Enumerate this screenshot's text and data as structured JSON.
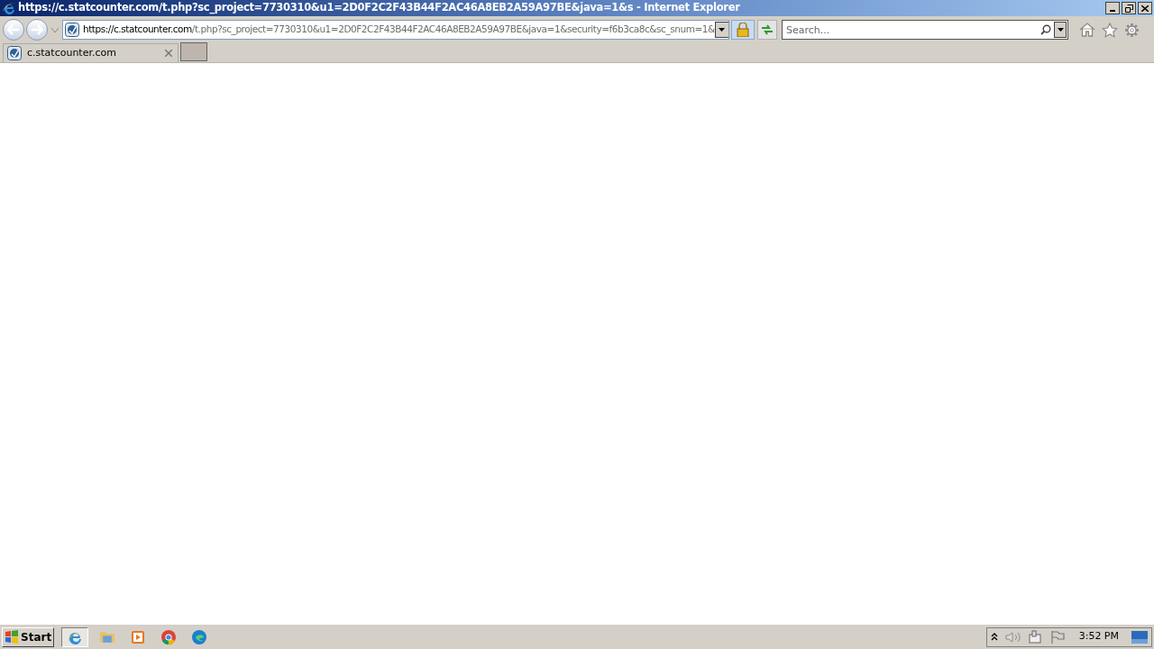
{
  "window": {
    "title": "https://c.statcounter.com/t.php?sc_project=7730310&u1=2D0F2C2F43B44F2AC46A8EB2A59A97BE&java=1&s - Internet Explorer"
  },
  "address_bar": {
    "scheme": "https://",
    "domain": "c.statcounter.com",
    "rest": "/t.php?sc_project=7730310&u1=2D0F2C2F43B44F2AC46A8EB2A59A97BE&java=1&security=f6b3ca8c&sc_snum=1&"
  },
  "search": {
    "placeholder": "Search..."
  },
  "tabs": [
    {
      "label": "c.statcounter.com",
      "selected": true
    }
  ],
  "taskbar": {
    "start": "Start",
    "apps": [
      {
        "kind": "ie",
        "selected": true
      },
      {
        "kind": "folder",
        "selected": false
      },
      {
        "kind": "media",
        "selected": false
      },
      {
        "kind": "chrome",
        "selected": false
      },
      {
        "kind": "edge",
        "selected": false
      }
    ],
    "tray": {
      "time": "3:52 PM"
    }
  }
}
